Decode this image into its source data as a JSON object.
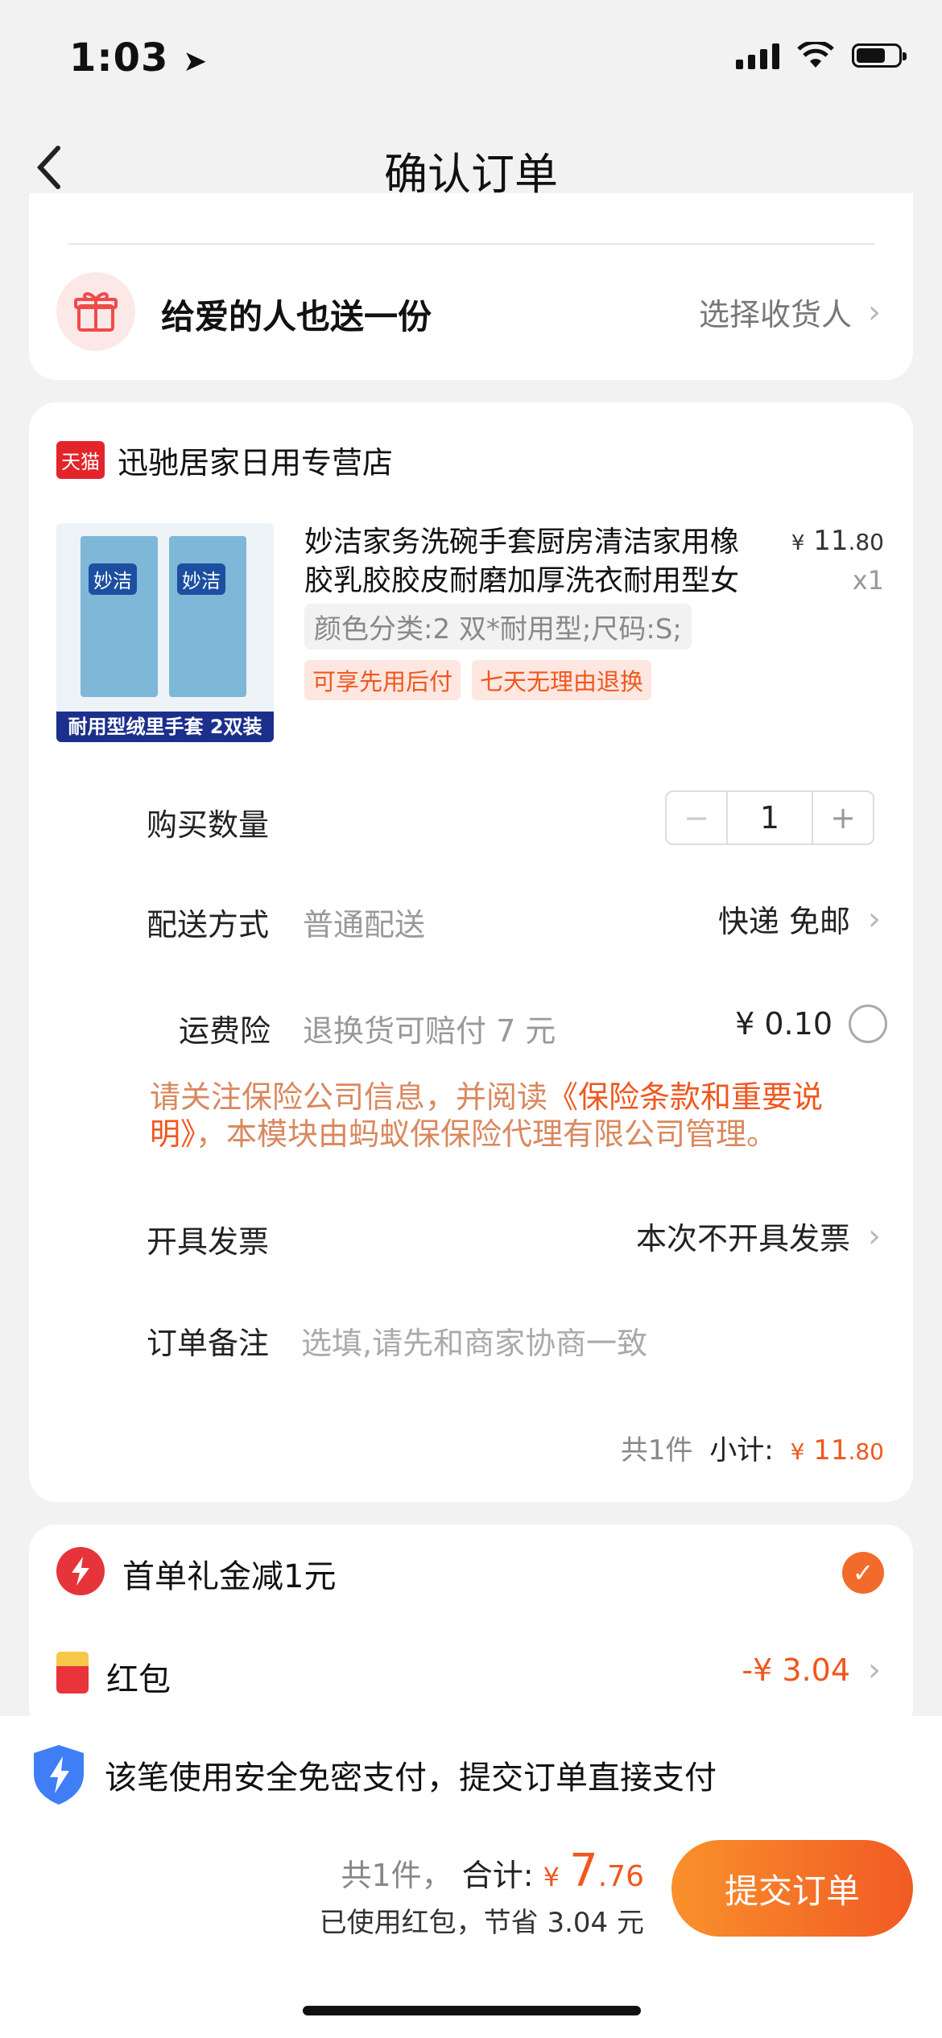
{
  "status": {
    "time": "1:03"
  },
  "nav": {
    "title": "确认订单"
  },
  "gift": {
    "title": "给爱的人也送一份",
    "action": "选择收货人"
  },
  "store": {
    "badge": "天猫",
    "name": "迅驰居家日用专营店"
  },
  "product": {
    "title": "妙洁家务洗碗手套厨房清洁家用橡胶乳胶胶皮耐磨加厚洗衣耐用型女",
    "spec": "颜色分类:2 双*耐用型;尺码:S;",
    "tags": [
      "可享先用后付",
      "七天无理由退换"
    ],
    "price_symbol": "¥",
    "price_int": "11",
    "price_dec": ".80",
    "qty_label": "x1",
    "image_banner": "耐用型绒里手套 2双装",
    "image_brand": "妙洁"
  },
  "quantity": {
    "label": "购买数量",
    "minus": "−",
    "value": "1",
    "plus": "+"
  },
  "shipping": {
    "label": "配送方式",
    "value": "普通配送",
    "right": "快递 免邮"
  },
  "insurance": {
    "label": "运费险",
    "value": "退换货可赔付 7 元",
    "price": "¥ 0.10"
  },
  "notice": {
    "prefix": "请关注保险公司信息，并阅读",
    "link": "《保险条款和重要说明》",
    "suffix": "，本模块由蚂蚁保保险代理有限公司管理。"
  },
  "invoice": {
    "label": "开具发票",
    "value": "本次不开具发票"
  },
  "remark": {
    "label": "订单备注",
    "placeholder": "选填,请先和商家协商一致"
  },
  "subtotal": {
    "count": "共1件",
    "label": "小计:",
    "symbol": "¥",
    "int": "11",
    "dec": ".80"
  },
  "discounts": {
    "first": {
      "label": "首单礼金减1元"
    },
    "redpacket": {
      "label": "红包",
      "value": "-¥ 3.04"
    }
  },
  "secure": {
    "text": "该笔使用安全免密支付，提交订单直接支付"
  },
  "total": {
    "count": "共1件，",
    "label": "合计:",
    "symbol": "¥",
    "int": "7",
    "dec": ".76",
    "saved": "已使用红包，节省 3.04 元"
  },
  "submit": {
    "label": "提交订单"
  },
  "colors": {
    "accent": "#f0571e",
    "button_start": "#f9912b",
    "button_end": "#f15a24"
  }
}
